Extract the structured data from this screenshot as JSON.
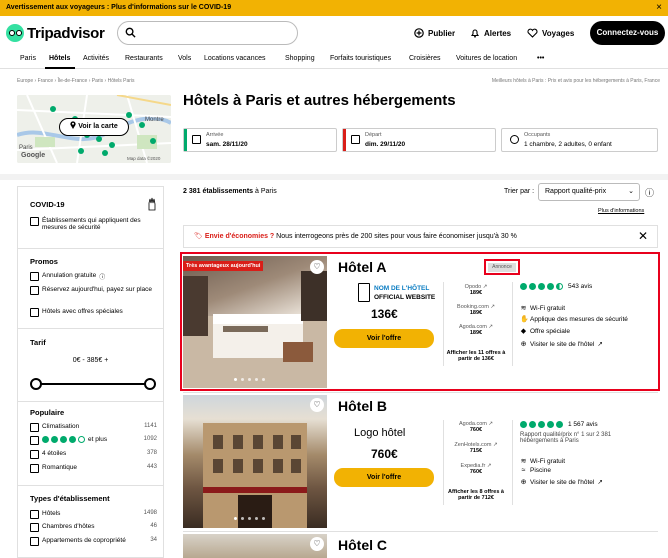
{
  "banner": {
    "text": "Avertissement aux voyageurs : Plus d'informations sur le COVID-19",
    "close": "×"
  },
  "header": {
    "logo": "Tripadvisor",
    "search_placeholder": "",
    "publish": "Publier",
    "alerts": "Alertes",
    "trips": "Voyages",
    "connect": "Connectez-vous"
  },
  "nav": [
    "Paris",
    "Hôtels",
    "Activités",
    "Restaurants",
    "Vols",
    "Locations vacances",
    "Shopping",
    "Forfaits touristiques",
    "Croisières",
    "Voitures de location",
    "•••"
  ],
  "breadcrumb": "Europe › France › Île-de-France › Paris › Hôtels Paris",
  "breadcrumb_right": "Meilleurs hôtels à Paris : Prix et avis pour les hébergements à Paris, France",
  "map": {
    "button": "Voir la carte",
    "google": "Google",
    "attribution": "Map data ©2020",
    "place1": "Paris",
    "place2": "Montre"
  },
  "page_title": "Hôtels à Paris et autres hébergements",
  "search_fields": {
    "arrival_label": "Arrivée",
    "arrival_value": "sam. 28/11/20",
    "departure_label": "Départ",
    "departure_value": "dim. 29/11/20",
    "guests_label": "Occupants",
    "guests_value": "1 chambre, 2 adultes, 0 enfant"
  },
  "sidebar": {
    "covid_title": "COVID-19",
    "covid_item": "Établissements qui appliquent des mesures de sécurité",
    "promos_title": "Promos",
    "promos": [
      "Annulation gratuite",
      "Réservez aujourd'hui, payez sur place",
      "Hôtels avec offres spéciales"
    ],
    "tarif_title": "Tarif",
    "tarif_range": "0€ - 385€ +",
    "popular_title": "Populaire",
    "popular": [
      {
        "label": "Climatisation",
        "count": "1141"
      },
      {
        "label": "et plus",
        "count": "1092"
      },
      {
        "label": "4 étoiles",
        "count": "378"
      },
      {
        "label": "Romantique",
        "count": "443"
      }
    ],
    "types_title": "Types d'établissement",
    "types": [
      {
        "label": "Hôtels",
        "count": "1498"
      },
      {
        "label": "Chambres d'hôtes",
        "count": "46"
      },
      {
        "label": "Appartements de copropriété",
        "count": "34"
      }
    ]
  },
  "results": {
    "count": "2 381 établissements",
    "count_suffix": "à Paris",
    "sort_label": "Trier par :",
    "sort_value": "Rapport qualité-prix",
    "info_link": "Plus d'informations",
    "promo_lead": "Envie d'économies ?",
    "promo_text": "Nous interrogeons près de 200 sites pour vous faire économiser jusqu'à 30 %"
  },
  "hotels": [
    {
      "badge": "Très avantageux aujourd'hui",
      "name": "Hôtel A",
      "ad": "Annonce",
      "logo_line1": "NOM DE L'HÔTEL",
      "logo_line2": "OFFICIAL WEBSITE",
      "price": "136€",
      "button": "Voir l'offre",
      "offers": [
        {
          "site": "Opodo",
          "price": "189€"
        },
        {
          "site": "Booking.com",
          "price": "189€"
        },
        {
          "site": "Agoda.com",
          "price": "189€"
        }
      ],
      "all_offers": "Afficher les 11 offres à partir de 136€",
      "rating": 4.5,
      "reviews": "543 avis",
      "ranking": "",
      "amenities": [
        {
          "icon": "wifi-icon",
          "label": "Wi-Fi gratuit"
        },
        {
          "icon": "safety-icon",
          "label": "Applique des mesures de sécurité"
        },
        {
          "icon": "tag-icon",
          "label": "Offre spéciale"
        },
        {
          "icon": "globe-icon",
          "label": "Visiter le site de l'hôtel"
        }
      ]
    },
    {
      "name": "Hôtel B",
      "logo_text": "Logo hôtel",
      "price": "760€",
      "button": "Voir l'offre",
      "offers": [
        {
          "site": "Agoda.com",
          "price": "760€"
        },
        {
          "site": "ZenHotels.com",
          "price": "715€"
        },
        {
          "site": "Expedia.fr",
          "price": "760€"
        }
      ],
      "all_offers": "Afficher les 8 offres à partir de 712€",
      "rating": 5,
      "reviews": "1 567 avis",
      "ranking": "Rapport qualité/prix n° 1 sur 2 381 hébergements à Paris",
      "amenities": [
        {
          "icon": "wifi-icon",
          "label": "Wi-Fi gratuit"
        },
        {
          "icon": "pool-icon",
          "label": "Piscine"
        },
        {
          "icon": "globe-icon",
          "label": "Visiter le site de l'hôtel"
        }
      ]
    },
    {
      "name": "Hôtel C"
    }
  ],
  "colors": {
    "accent": "#34e0a1",
    "cta": "#f2b203",
    "rating": "#00aa6c",
    "highlight": "#e8001c"
  }
}
